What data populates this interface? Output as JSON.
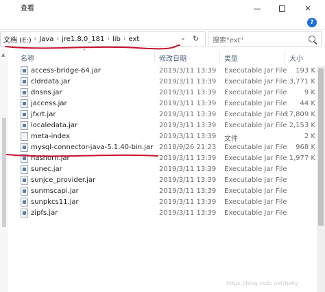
{
  "titlebar": {
    "menu_view": "查看",
    "minimize": "—",
    "close": "✕"
  },
  "help": "?",
  "address": {
    "crumbs": [
      "文档 (E:)",
      "Java",
      "jre1.8.0_181",
      "lib",
      "ext"
    ],
    "separator": "›"
  },
  "search": {
    "placeholder": "搜索\"ext\""
  },
  "columns": {
    "name": "名称",
    "date": "修改日期",
    "type": "类型",
    "size": "大小"
  },
  "files": [
    {
      "name": "access-bridge-64.jar",
      "date": "2019/3/11 13:39",
      "type": "Executable Jar File",
      "size": "193 K",
      "icon": "jar-file-icon"
    },
    {
      "name": "cldrdata.jar",
      "date": "2019/3/11 13:39",
      "type": "Executable Jar File",
      "size": "3,771 K",
      "icon": "jar-file-icon"
    },
    {
      "name": "dnsns.jar",
      "date": "2019/3/11 13:39",
      "type": "Executable Jar File",
      "size": "9 K",
      "icon": "jar-file-icon"
    },
    {
      "name": "jaccess.jar",
      "date": "2019/3/11 13:39",
      "type": "Executable Jar File",
      "size": "44 K",
      "icon": "jar-file-icon"
    },
    {
      "name": "jfxrt.jar",
      "date": "2019/3/11 13:39",
      "type": "Executable Jar File",
      "size": "17,809 K",
      "icon": "jar-file-icon"
    },
    {
      "name": "localedata.jar",
      "date": "2019/3/11 13:39",
      "type": "Executable Jar File",
      "size": "2,153 K",
      "icon": "jar-file-icon"
    },
    {
      "name": "meta-index",
      "date": "2019/3/11 13:39",
      "type": "文件",
      "size": "2 K",
      "icon": "file-icon"
    },
    {
      "name": "mysql-connector-java-5.1.40-bin.jar",
      "date": "2018/9/26 21:23",
      "type": "Executable Jar File",
      "size": "968 K",
      "icon": "jar-file-icon"
    },
    {
      "name": "nashorn.jar",
      "date": "2019/3/11 13:39",
      "type": "Executable Jar File",
      "size": "1,977 K",
      "icon": "jar-file-icon"
    },
    {
      "name": "sunec.jar",
      "date": "2019/3/11 13:39",
      "type": "Executable Jar File",
      "size": "",
      "icon": "jar-file-icon"
    },
    {
      "name": "sunjce_provider.jar",
      "date": "2019/3/11 13:39",
      "type": "Executable Jar File",
      "size": "",
      "icon": "jar-file-icon"
    },
    {
      "name": "sunmscapi.jar",
      "date": "2019/3/11 13:39",
      "type": "Executable Jar File",
      "size": "",
      "icon": "jar-file-icon"
    },
    {
      "name": "sunpkcs11.jar",
      "date": "2019/3/11 13:39",
      "type": "Executable Jar File",
      "size": "",
      "icon": "jar-file-icon"
    },
    {
      "name": "zipfs.jar",
      "date": "2019/3/11 13:39",
      "type": "Executable Jar File",
      "size": "",
      "icon": "jar-file-icon"
    }
  ],
  "watermark": "https://blog.csdn.net/heliy",
  "colors": {
    "annotation": "#c8102e",
    "header_text": "#4c607a"
  }
}
